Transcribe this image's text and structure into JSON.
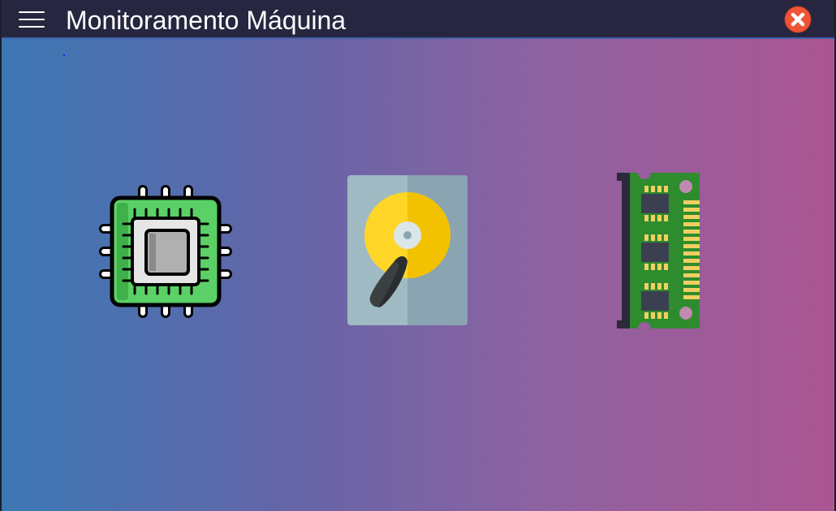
{
  "app": {
    "title": "Monitoramento Máquina"
  },
  "header": {
    "menu_icon": "hamburger-menu-icon",
    "close_icon": "close-x-circle-icon"
  },
  "devices": [
    {
      "id": "cpu",
      "icon": "cpu-chip-icon"
    },
    {
      "id": "disk",
      "icon": "hard-disk-icon"
    },
    {
      "id": "memory",
      "icon": "ram-memory-icon"
    }
  ],
  "colors": {
    "titlebar": "#262640",
    "gradient_start": "#3c78b4",
    "gradient_end": "#ab5592",
    "close_button": "#ef5435",
    "cpu_board": "#5bd066",
    "disk_platter": "#ffd02a",
    "ram_board": "#2e8b2e"
  }
}
